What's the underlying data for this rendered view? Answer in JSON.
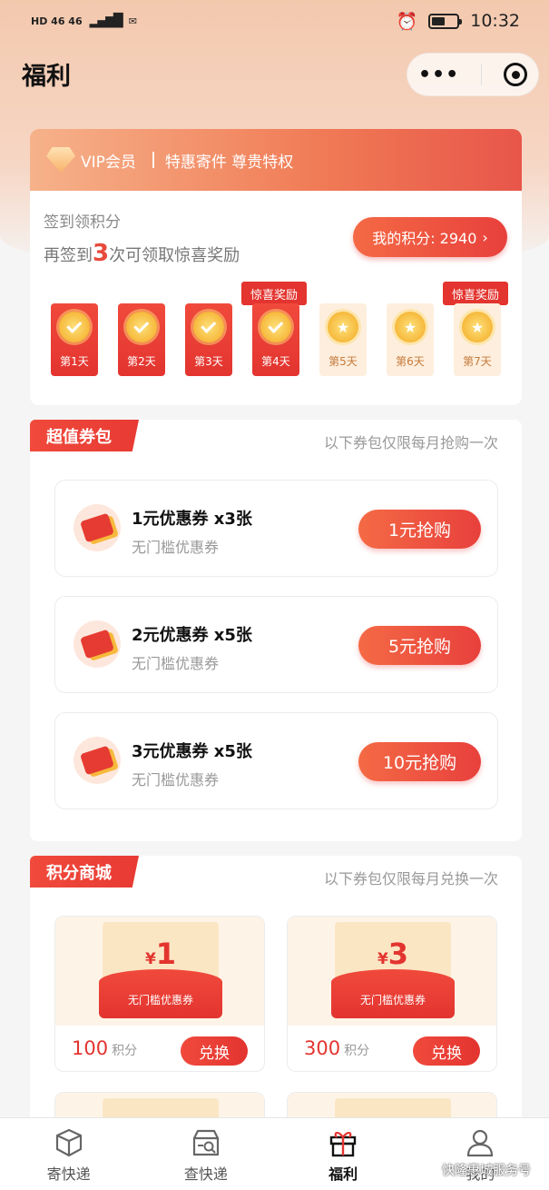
{
  "status": {
    "left": "HD 46 46",
    "time": "10:32"
  },
  "nav": {
    "title": "福利"
  },
  "vip": {
    "label": "VIP会员",
    "slogan": "特惠寄件 尊贵特权",
    "checkin_title": "签到领积分",
    "checkin_prefix": "再签到",
    "checkin_count": "3",
    "checkin_suffix": "次可领取惊喜奖励",
    "points_label": "我的积分: 2940",
    "surprise_tag": "惊喜奖励",
    "days": [
      {
        "label": "第1天",
        "done": true
      },
      {
        "label": "第2天",
        "done": true
      },
      {
        "label": "第3天",
        "done": true
      },
      {
        "label": "第4天",
        "done": true
      },
      {
        "label": "第5天",
        "done": false
      },
      {
        "label": "第6天",
        "done": false
      },
      {
        "label": "第7天",
        "done": false
      }
    ]
  },
  "packs": {
    "title": "超值券包",
    "note": "以下券包仅限每月抢购一次",
    "items": [
      {
        "title": "1元优惠券 x3张",
        "sub": "无门槛优惠券",
        "button": "1元抢购"
      },
      {
        "title": "2元优惠券 x5张",
        "sub": "无门槛优惠券",
        "button": "5元抢购"
      },
      {
        "title": "3元优惠券 x5张",
        "sub": "无门槛优惠券",
        "button": "10元抢购"
      }
    ]
  },
  "shop": {
    "title": "积分商城",
    "note": "以下券包仅限每月兑换一次",
    "items": [
      {
        "yen": "¥",
        "amount": "1",
        "label": "无门槛优惠券",
        "points": "100",
        "unit": "积分",
        "button": "兑换"
      },
      {
        "yen": "¥",
        "amount": "3",
        "label": "无门槛优惠券",
        "points": "300",
        "unit": "积分",
        "button": "兑换"
      }
    ]
  },
  "tabs": [
    {
      "label": "寄快递",
      "icon": "package-icon"
    },
    {
      "label": "查快递",
      "icon": "store-search-icon"
    },
    {
      "label": "福利",
      "icon": "gift-icon"
    },
    {
      "label": "我的",
      "icon": "user-icon"
    }
  ],
  "watermark": "快隆惠城服务号"
}
